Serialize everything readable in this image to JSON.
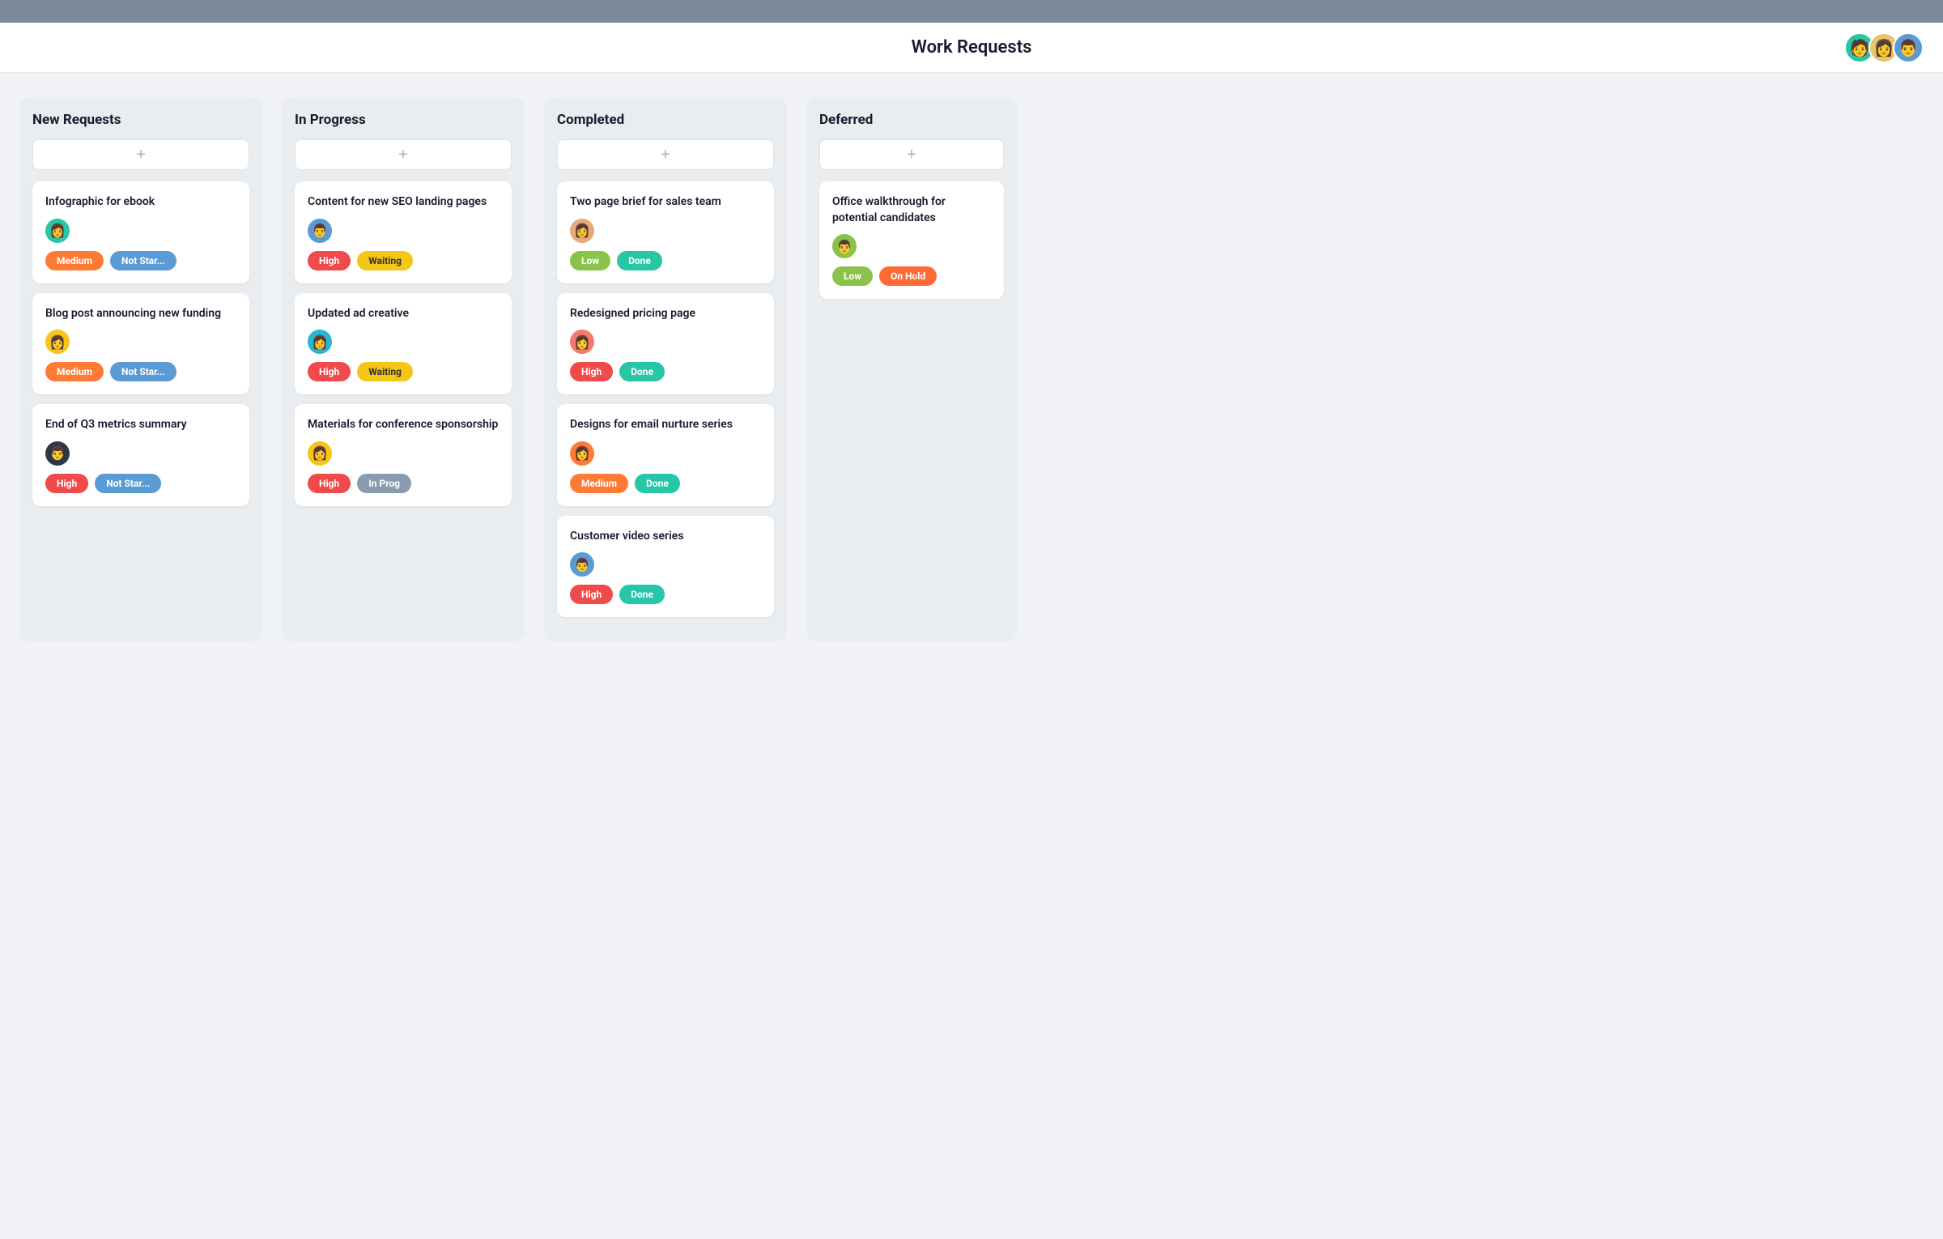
{
  "header": {
    "title": "Work Requests",
    "avatars": [
      {
        "id": "av1",
        "bg": "#26c6a6",
        "emoji": "👩"
      },
      {
        "id": "av2",
        "bg": "#f5c518",
        "emoji": "👩"
      },
      {
        "id": "av3",
        "bg": "#5b9bd5",
        "emoji": "👨"
      }
    ]
  },
  "columns": [
    {
      "id": "new-requests",
      "title": "New Requests",
      "cards": [
        {
          "id": "card-1",
          "title": "Infographic for ebook",
          "avatar_bg": "#26c6a6",
          "avatar_emoji": "👩",
          "priority": "Medium",
          "priority_class": "badge-medium",
          "status": "Not Star...",
          "status_class": "badge-not-started"
        },
        {
          "id": "card-2",
          "title": "Blog post announcing new funding",
          "avatar_bg": "#f5c518",
          "avatar_emoji": "👩",
          "priority": "Medium",
          "priority_class": "badge-medium",
          "status": "Not Star...",
          "status_class": "badge-not-started"
        },
        {
          "id": "card-3",
          "title": "End of Q3 metrics summary",
          "avatar_bg": "#2d3748",
          "avatar_emoji": "👨",
          "priority": "High",
          "priority_class": "badge-high",
          "status": "Not Star...",
          "status_class": "badge-not-started"
        }
      ]
    },
    {
      "id": "in-progress",
      "title": "In Progress",
      "cards": [
        {
          "id": "card-4",
          "title": "Content for new SEO landing pages",
          "avatar_bg": "#5b9bd5",
          "avatar_emoji": "👨",
          "priority": "High",
          "priority_class": "badge-high",
          "status": "Waiting",
          "status_class": "badge-waiting"
        },
        {
          "id": "card-5",
          "title": "Updated ad creative",
          "avatar_bg": "#26b5d5",
          "avatar_emoji": "👩",
          "priority": "High",
          "priority_class": "badge-high",
          "status": "Waiting",
          "status_class": "badge-waiting"
        },
        {
          "id": "card-6",
          "title": "Materials for conference sponsorship",
          "avatar_bg": "#f5c518",
          "avatar_emoji": "👩",
          "priority": "High",
          "priority_class": "badge-high",
          "status": "In Prog",
          "status_class": "badge-in-progress"
        }
      ]
    },
    {
      "id": "completed",
      "title": "Completed",
      "cards": [
        {
          "id": "card-7",
          "title": "Two page brief for sales team",
          "avatar_bg": "#e8a87c",
          "avatar_emoji": "👩",
          "priority": "Low",
          "priority_class": "badge-low",
          "status": "Done",
          "status_class": "badge-done"
        },
        {
          "id": "card-8",
          "title": "Redesigned pricing page",
          "avatar_bg": "#f57a6b",
          "avatar_emoji": "👩",
          "priority": "High",
          "priority_class": "badge-high",
          "status": "Done",
          "status_class": "badge-done"
        },
        {
          "id": "card-9",
          "title": "Designs for email nurture series",
          "avatar_bg": "#ff7a35",
          "avatar_emoji": "👩",
          "priority": "Medium",
          "priority_class": "badge-medium",
          "status": "Done",
          "status_class": "badge-done"
        },
        {
          "id": "card-10",
          "title": "Customer video series",
          "avatar_bg": "#5b9bd5",
          "avatar_emoji": "👨",
          "priority": "High",
          "priority_class": "badge-high",
          "status": "Done",
          "status_class": "badge-done"
        }
      ]
    },
    {
      "id": "deferred",
      "title": "Deferred",
      "cards": [
        {
          "id": "card-11",
          "title": "Office walkthrough for potential candidates",
          "avatar_bg": "#8bc34a",
          "avatar_emoji": "👨",
          "priority": "Low",
          "priority_class": "badge-low",
          "status": "On Hold",
          "status_class": "badge-on-hold"
        }
      ]
    }
  ],
  "add_label": "+"
}
